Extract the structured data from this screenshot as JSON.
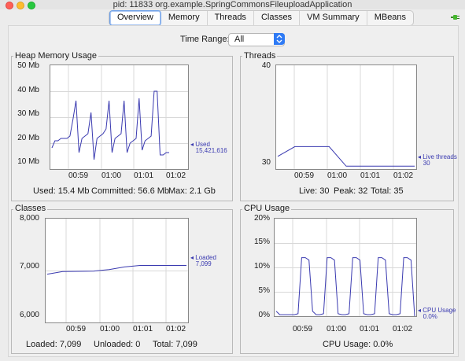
{
  "window": {
    "title": "pid: 11833 org.example.SpringCommonsFileuploadApplication"
  },
  "tabs": [
    "Overview",
    "Memory",
    "Threads",
    "Classes",
    "VM Summary",
    "MBeans"
  ],
  "active_tab": "Overview",
  "time_range": {
    "label": "Time Range:",
    "value": "All"
  },
  "colors": {
    "series": "#3a3ab0",
    "accent": "#2f7bf5"
  },
  "icons": {
    "connection": "plug-icon"
  },
  "panels": {
    "heap": {
      "title": "Heap Memory Usage",
      "series_label": "Used",
      "series_value": "15,421,616",
      "stats": {
        "used": "Used: 15.4 Mb",
        "committed": "Committed: 56.6 Mb",
        "max": "Max: 2.1 Gb"
      },
      "yticks": [
        "50 Mb",
        "40 Mb",
        "30 Mb",
        "20 Mb",
        "10 Mb"
      ],
      "xticks": [
        "00:59",
        "01:00",
        "01:01",
        "01:02"
      ]
    },
    "threads": {
      "title": "Threads",
      "series_label": "Live threads",
      "series_value": "30",
      "stats": {
        "live": "Live: 30",
        "peak": "Peak: 32",
        "total": "Total: 35"
      },
      "yticks": [
        "40",
        "30"
      ],
      "xticks": [
        "00:59",
        "01:00",
        "01:01",
        "01:02"
      ]
    },
    "classes": {
      "title": "Classes",
      "series_label": "Loaded",
      "series_value": "7,099",
      "stats": {
        "loaded": "Loaded: 7,099",
        "unloaded": "Unloaded: 0",
        "total": "Total: 7,099"
      },
      "yticks": [
        "8,000",
        "7,000",
        "6,000"
      ],
      "xticks": [
        "00:59",
        "01:00",
        "01:01",
        "01:02"
      ]
    },
    "cpu": {
      "title": "CPU Usage",
      "series_label": "CPU Usage",
      "series_value": "0.0%",
      "stats": {
        "usage": "CPU Usage: 0.0%"
      },
      "yticks": [
        "20%",
        "15%",
        "10%",
        "5%",
        "0%"
      ],
      "xticks": [
        "00:59",
        "01:00",
        "01:01",
        "01:02"
      ]
    }
  },
  "chart_data": [
    {
      "type": "line",
      "title": "Heap Memory Usage",
      "ylabel": "Mb",
      "ylim": [
        8,
        52
      ],
      "x": [
        0,
        1,
        2,
        3,
        4,
        5,
        6,
        7,
        8,
        9,
        10,
        11,
        12,
        13,
        14,
        15,
        16,
        17,
        18,
        19,
        20,
        21,
        22,
        23,
        24,
        25,
        26,
        27,
        28,
        29,
        30,
        31,
        32,
        33,
        34,
        35,
        36,
        37,
        38,
        39
      ],
      "series": [
        {
          "name": "Used",
          "values": [
            17,
            20,
            20,
            21,
            21,
            21,
            22,
            29,
            37,
            15,
            21,
            22,
            23,
            32,
            12,
            21,
            22,
            23,
            25,
            37,
            15,
            21,
            22,
            23,
            37,
            15,
            19,
            20,
            21,
            38,
            16,
            20,
            21,
            22,
            41,
            41,
            14,
            14,
            15,
            15
          ]
        }
      ],
      "grid": true
    },
    {
      "type": "line",
      "title": "Threads",
      "ylim": [
        29.7,
        40.3
      ],
      "x": [
        0,
        1,
        2,
        3,
        4,
        5,
        6,
        7,
        8
      ],
      "series": [
        {
          "name": "Live threads",
          "values": [
            31,
            32,
            32,
            32,
            30,
            30,
            30,
            30,
            30
          ]
        }
      ],
      "grid": true
    },
    {
      "type": "line",
      "title": "Classes",
      "ylim": [
        6000,
        8000
      ],
      "x": [
        0,
        1,
        2,
        3,
        4,
        5,
        6,
        7,
        8,
        9
      ],
      "series": [
        {
          "name": "Loaded",
          "values": [
            6930,
            6980,
            6985,
            6990,
            7020,
            7070,
            7099,
            7099,
            7099,
            7099
          ]
        }
      ],
      "grid": true
    },
    {
      "type": "line",
      "title": "CPU Usage",
      "ylabel": "%",
      "ylim": [
        0,
        20
      ],
      "x": [
        0,
        1,
        2,
        3,
        4,
        5,
        6,
        7,
        8,
        9,
        10,
        11,
        12,
        13,
        14,
        15,
        16,
        17,
        18,
        19,
        20,
        21,
        22,
        23,
        24,
        25,
        26,
        27,
        28,
        29,
        30,
        31,
        32,
        33,
        34,
        35,
        36,
        37,
        38
      ],
      "series": [
        {
          "name": "CPU Usage",
          "values": [
            1,
            0.3,
            0.3,
            0.3,
            0.3,
            0.3,
            0.5,
            12,
            12,
            11.5,
            1,
            0.3,
            0.3,
            0.5,
            12,
            12,
            11.5,
            0.5,
            0.3,
            0.3,
            0.5,
            12,
            12,
            11.5,
            0.5,
            0.3,
            0.3,
            0.5,
            12,
            12,
            11.5,
            0.5,
            0.3,
            0.3,
            0.5,
            12,
            12,
            11.5,
            0
          ]
        }
      ],
      "grid": true
    }
  ]
}
